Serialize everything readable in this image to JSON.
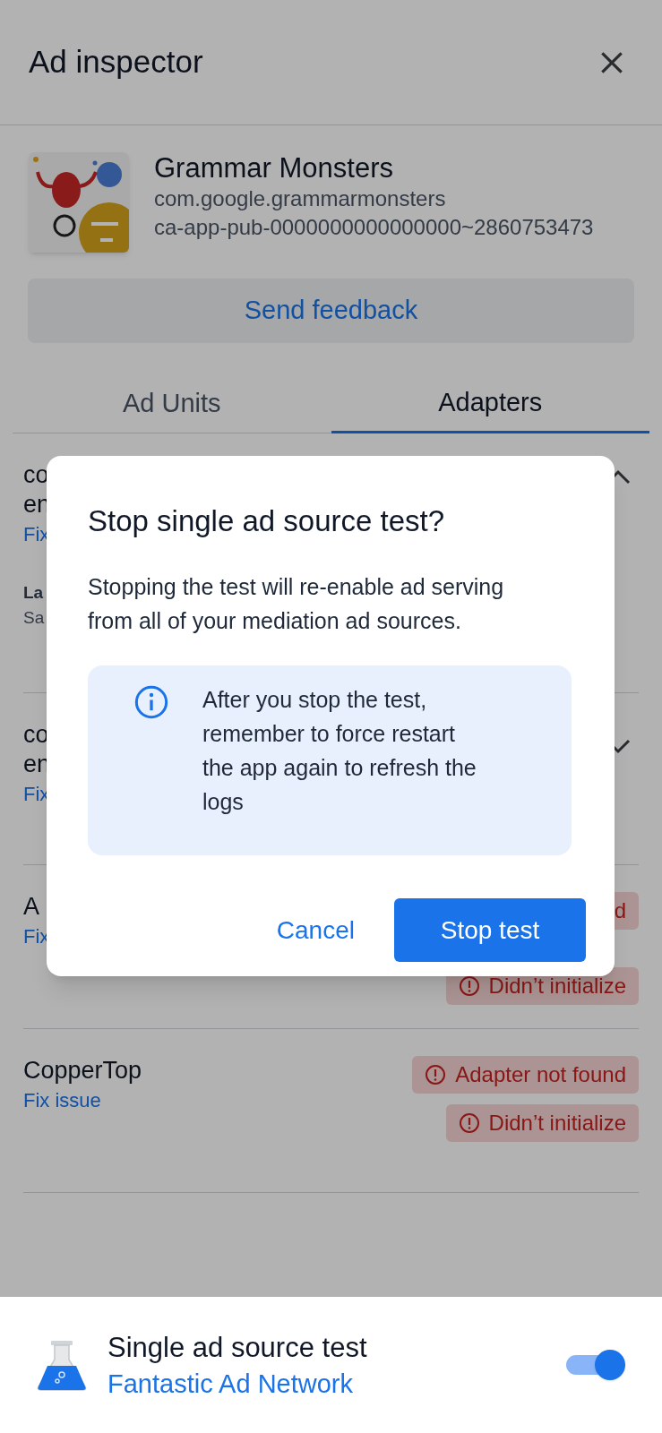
{
  "header": {
    "title": "Ad inspector"
  },
  "app": {
    "name": "Grammar Monsters",
    "package": "com.google.grammarmonsters",
    "app_id": "ca-app-pub-0000000000000000~2860753473"
  },
  "feedback_button": "Send feedback",
  "tabs": [
    {
      "label": "Ad Units",
      "selected": false
    },
    {
      "label": "Adapters",
      "selected": true
    }
  ],
  "adapters": [
    {
      "title_lines": [
        "co",
        "en"
      ],
      "link": "Fix",
      "details": [
        {
          "label": "La",
          "value": "Sa"
        }
      ],
      "expanded": true
    },
    {
      "title_lines": [
        "co",
        "en"
      ],
      "link": "Fix",
      "expanded": false
    },
    {
      "title_lines": [
        "A"
      ],
      "link": "Fix",
      "badges": [
        {
          "text": "d"
        },
        {
          "text": "Didn’t initialize",
          "icon": true
        }
      ]
    },
    {
      "title_lines": [
        "CopperTop"
      ],
      "link": "Fix issue",
      "badges": [
        {
          "text": "Adapter not found",
          "icon": true
        },
        {
          "text": "Didn’t initialize",
          "icon": true
        }
      ]
    }
  ],
  "dialog": {
    "title": "Stop single ad source test?",
    "body": "Stopping the test will re-enable ad serving from all of your mediation ad sources.",
    "info": "After you stop the test, remember to force restart the app again to refresh the logs",
    "buttons": [
      {
        "label": "Cancel",
        "kind": "text"
      },
      {
        "label": "Stop test",
        "kind": "filled"
      }
    ]
  },
  "test_bar": {
    "title": "Single ad source test",
    "network": "Fantastic Ad Network",
    "on": true
  }
}
